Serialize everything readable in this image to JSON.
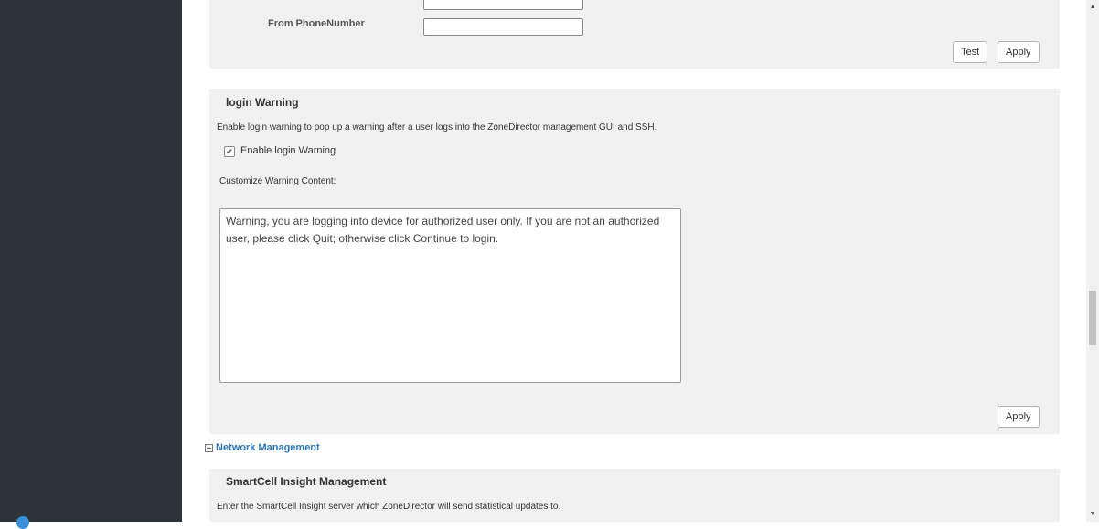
{
  "email_settings": {
    "from_phone_label": "From PhoneNumber",
    "from_phone_value": "",
    "test_button": "Test",
    "apply_button": "Apply"
  },
  "login_warning": {
    "title": "login Warning",
    "description": "Enable login warning to pop up a warning after a user logs into the ZoneDirector management GUI and SSH.",
    "checkbox_label": "Enable login Warning",
    "checkbox_checked": true,
    "customize_label": "Customize Warning Content:",
    "content": "Warning, you are logging into device for authorized user only. If you are not an authorized user, please click Quit; otherwise click Continue to login.",
    "apply_button": "Apply"
  },
  "network_management": {
    "label": "Network Management",
    "icon": "collapse-minus-icon"
  },
  "smartcell": {
    "title": "SmartCell Insight Management",
    "description": "Enter the SmartCell Insight server which ZoneDirector will send statistical updates to."
  },
  "colors": {
    "sidebar": "#2c3339",
    "panel": "#f1f1f1",
    "link": "#2e75b6"
  }
}
